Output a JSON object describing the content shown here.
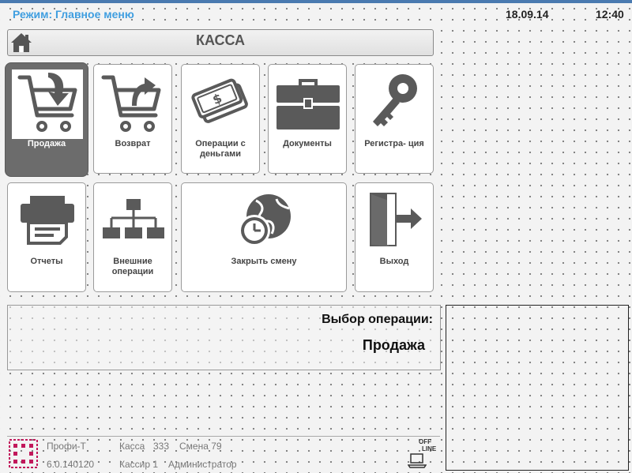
{
  "status_bar": {
    "mode": "Режим: Главное меню",
    "date": "18.09.14",
    "time": "12:40"
  },
  "header": {
    "title": "КАССА",
    "home_icon": "home-icon"
  },
  "tiles": [
    {
      "label": "Продажа",
      "icon": "cart-in-icon",
      "selected": true
    },
    {
      "label": "Возврат",
      "icon": "cart-return-icon",
      "selected": false
    },
    {
      "label": "Операции с деньгами",
      "icon": "money-icon",
      "selected": false
    },
    {
      "label": "Документы",
      "icon": "briefcase-icon",
      "selected": false
    },
    {
      "label": "Регистра- ция",
      "icon": "key-icon",
      "selected": false
    },
    {
      "label": "Отчеты",
      "icon": "printer-icon",
      "selected": false
    },
    {
      "label": "Внешние операции",
      "icon": "network-icon",
      "selected": false
    },
    {
      "label": "Закрыть смену",
      "icon": "globe-clock-icon",
      "selected": false
    },
    {
      "label": "Выход",
      "icon": "exit-icon",
      "selected": false
    }
  ],
  "operation_panel": {
    "label": "Выбор операции:",
    "value": "Продажа"
  },
  "footer": {
    "app_name": "Профи-Т",
    "version": "6.0.140120",
    "kassa_label": "Касса",
    "kassa_number": "333",
    "shift": "Смена 79",
    "cashier": "Кассир 1",
    "role": "Администратор",
    "offline_line1": "OFF",
    "offline_line2": "LINE"
  },
  "colors": {
    "accent": "#3f9ee0",
    "icon": "#5a5a5a",
    "selected_tile": "#6c6c6c",
    "logo": "#c2185b"
  }
}
